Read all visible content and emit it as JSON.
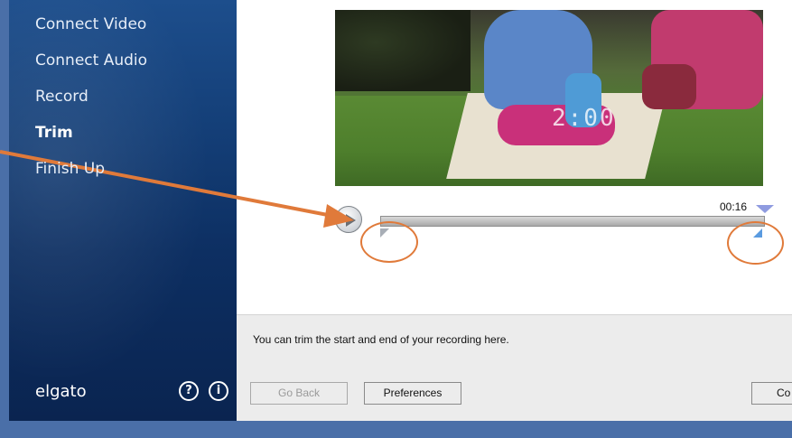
{
  "sidebar": {
    "items": [
      {
        "label": "Connect Video",
        "active": false
      },
      {
        "label": "Connect Audio",
        "active": false
      },
      {
        "label": "Record",
        "active": false
      },
      {
        "label": "Trim",
        "active": true
      },
      {
        "label": "Finish Up",
        "active": false
      }
    ],
    "brand": "elgato",
    "icons": [
      "help-icon",
      "info-icon"
    ],
    "help_glyph": "?",
    "info_glyph": "i"
  },
  "video": {
    "timestamp_overlay": "2:00"
  },
  "timeline": {
    "duration_label": "00:16",
    "trim_start_fraction": 0.0,
    "trim_end_fraction": 1.0
  },
  "panel": {
    "instruction": "You can trim the start and end of your recording here.",
    "buttons": {
      "go_back": "Go Back",
      "preferences": "Preferences",
      "continue": "Co"
    }
  },
  "colors": {
    "sidebar_top": "#1d4e8c",
    "sidebar_bottom": "#0a2450",
    "annotation": "#e07a3a",
    "playhead": "#8f9be0"
  }
}
